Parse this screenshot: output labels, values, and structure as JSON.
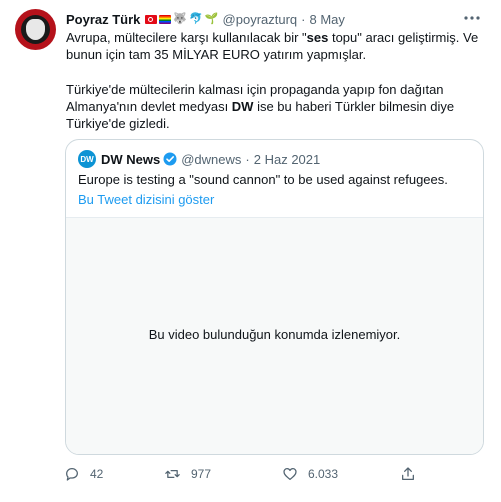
{
  "tweet": {
    "author_name": "Poyraz Türk",
    "author_handle": "@poyrazturq",
    "separator": "·",
    "date": "8 May",
    "badge_emojis": [
      "🐺",
      "🐬",
      "🌱"
    ],
    "body_p1": [
      {
        "t": "Avrupa, mültecilere karşı kullanılacak bir \""
      },
      {
        "t": "ses",
        "b": true
      },
      {
        "t": " topu\" aracı geliştirmiş. Ve bunun için tam 35 MİLYAR EURO yatırım yapmışlar."
      }
    ],
    "body_p2": [
      {
        "t": "Türkiye'de mültecilerin kalması için propaganda yapıp fon dağıtan Almanya'nın devlet medyası "
      },
      {
        "t": "DW",
        "b": true
      },
      {
        "t": " ise bu haberi Türkler bilmesin diye Türkiye'de gizledi."
      }
    ]
  },
  "quote": {
    "avatar_text": "DW",
    "name": "DW News",
    "handle": "@dwnews",
    "separator": "·",
    "date": "2 Haz 2021",
    "text": "Europe is testing a \"sound cannon\" to be used against refugees.",
    "thread_link": "Bu Tweet dizisini göster",
    "video_message": "Bu video bulunduğun konumda izlenemiyor."
  },
  "actions": {
    "replies": "42",
    "retweets": "977",
    "likes": "6.033"
  },
  "colors": {
    "accent": "#1d9bf0",
    "secondary_text": "#536471",
    "border": "#cfd9de"
  },
  "icons": [
    "more-icon",
    "verified-icon",
    "reply-icon",
    "retweet-icon",
    "like-icon",
    "share-icon"
  ]
}
